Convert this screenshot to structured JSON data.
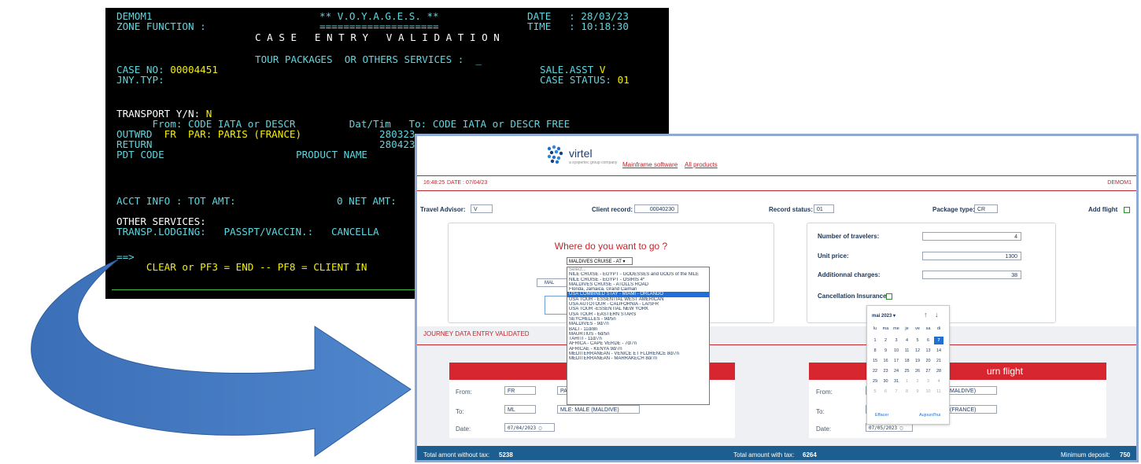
{
  "terminal": {
    "r1_left": "DEMOM1",
    "r1_mid": "** V.O.Y.A.G.E.S. **",
    "r1_date_label": "DATE   : ",
    "r1_date": "28/03/23",
    "r2_left": "ZONE FUNCTION :",
    "r2_mid": "====================",
    "r2_time_label": "TIME   : ",
    "r2_time": "10:18:30",
    "r3_title": "C A S E   E N T R Y   V A L I D A T I O N",
    "r5_services": "TOUR PACKAGES  OR OTHERS SERVICES :  _",
    "r6_case_label": "CASE NO: ",
    "r6_case_value": "00004451",
    "r6_sale_label": "SALE.ASST ",
    "r6_sale_value": "V",
    "r7_jny": "JNY.TYP:",
    "r7_status_label": "CASE STATUS: ",
    "r7_status_value": "01",
    "r9_transport_label": "TRANSPORT Y/N: ",
    "r9_transport_value": "N",
    "r10_headers": "      From: CODE IATA or DESCR         Dat/Tim   To: CODE IATA or DESCR FREE",
    "r11_outwrd_label": "OUTWRD  ",
    "r11_outwrd_value": "FR  PAR: PARIS (FRANCE)",
    "r11_outwrd_date": "280323",
    "r12_return": "RETURN",
    "r12_return_date": "280423",
    "r13_pdt": "PDT CODE",
    "r13_product": "PRODUCT NAME",
    "r17_acct": "ACCT INFO : TOT AMT:",
    "r17_zero": "0 NET AMT:",
    "r19_other": "OTHER SERVICES:",
    "r20_transp": "TRANSP.LODGING:   PASSPT/VACCIN.:   CANCELLA",
    "r22_prompt": "==>",
    "r23_keys": "     CLEAR or PF3 = END -- PF8 = CLIENT IN"
  },
  "header": {
    "logo_name": "virtel",
    "logo_sub": "a syspertec group company",
    "nav": [
      "Mainframe software",
      "All products"
    ]
  },
  "status": {
    "time": "16:48:25",
    "date": "DATE :  07/04/23",
    "user": "DEMOM1"
  },
  "form": {
    "advisor_label": "Travel Advisor:",
    "advisor_value": "V",
    "client_label": "Client record:",
    "client_value": "00040230",
    "record_label": "Record status:",
    "record_value": "01",
    "package_label": "Package type:",
    "package_value": "CR",
    "add_flight": "Add flight"
  },
  "where": {
    "title": "Where do you want to go ?",
    "select_value": "MALDIVES CRUISE - AT",
    "ghost_value": "MAL",
    "options": [
      "Select...",
      "NILE CRUISE - EGYPT - GODESSES and GODS of the NILE",
      "NILE CRUISE - EGYPT - OSIRIS 4*",
      "MALDIVES CRUISE - ATOLLS ROAD",
      "Florida, Jamaica, Grand Caiman",
      "USA COMBINED STAY - MIAMI - ORLANDO",
      "USA TOUR - ESSENTIAL WEST AMERICAN",
      "USA AUTOTOUR - CALIFORNIA - LA/SFR",
      "USA TOUR -ESSENTIAL NEW YORK",
      "USA TOUR - EASTERN STARS",
      "SEYCHELLES - 9d/5n",
      "MALDIVES - 9d/7n",
      "BALI - 11d/8n",
      "MAURTIUS - 6d/5n",
      "TAHITI - 11d/7n",
      "AFRICA - CAPE VERDE - 7d/7n",
      "AFRICAE - KENYA 9d/7n",
      "MEDITERRANEAN - VENICE ET FLORENCE 8d/7n",
      "MEDITERRANEAN - MARRAKECH 8d/7n"
    ],
    "selected_index": 5
  },
  "pricing": {
    "travelers_label": "Number of travelers:",
    "travelers_value": "4",
    "unit_label": "Unit price:",
    "unit_value": "1300",
    "charges_label": "Additionnal charges:",
    "charges_value": "38",
    "insurance_label": "Cancellation Insurance"
  },
  "validated": "JOURNEY DATA ENTRY VALIDATED",
  "outbound": {
    "from_label": "From:",
    "from_code": "FR",
    "from_desc": "PA",
    "to_label": "To:",
    "to_code": "ML",
    "to_desc": "MLE: MALE (MALDIVE)",
    "date_label": "Date:",
    "date_value": "07/04/2023"
  },
  "return": {
    "title": "urn flight",
    "from_label": "From:",
    "from_desc": "MALDIVE)",
    "to_label": "To:",
    "to_desc": "(FRANCE)",
    "date_label": "Date:",
    "date_value": "07/05/2023"
  },
  "calendar": {
    "month": "mai 2023 ▾",
    "days": [
      "lu",
      "ma",
      "me",
      "je",
      "ve",
      "sa",
      "di"
    ],
    "weeks": [
      [
        "1",
        "2",
        "3",
        "4",
        "5",
        "6",
        "7"
      ],
      [
        "8",
        "9",
        "10",
        "11",
        "12",
        "13",
        "14"
      ],
      [
        "15",
        "16",
        "17",
        "18",
        "19",
        "20",
        "21"
      ],
      [
        "22",
        "23",
        "24",
        "25",
        "26",
        "27",
        "28"
      ],
      [
        "29",
        "30",
        "31",
        "1",
        "2",
        "3",
        "4"
      ],
      [
        "5",
        "6",
        "7",
        "8",
        "9",
        "10",
        "11"
      ]
    ],
    "clear": "Effacer",
    "today": "Aujourd'hui"
  },
  "footer": {
    "no_tax_label": "Total amont without tax:",
    "no_tax_value": "5238",
    "tax_label": "Total amount with tax:",
    "tax_value": "6264",
    "deposit_label": "Minimum deposit:",
    "deposit_value": "750"
  }
}
